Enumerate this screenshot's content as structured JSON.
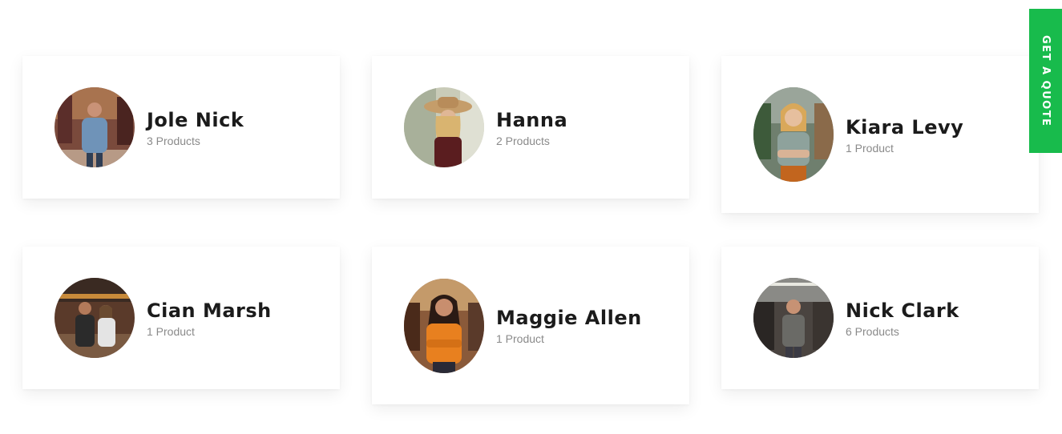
{
  "sellers": [
    {
      "name": "Jole Nick",
      "products": "3 Products",
      "photo": "man-denim-shirt-bike-shop"
    },
    {
      "name": "Hanna",
      "products": "2 Products",
      "photo": "woman-straw-hat-laughing"
    },
    {
      "name": "Kiara Levy",
      "products": "1 Product",
      "photo": "woman-arms-crossed-shop"
    },
    {
      "name": "Cian Marsh",
      "products": "1 Product",
      "photo": "couple-in-bike-shop"
    },
    {
      "name": "Maggie Allen",
      "products": "1 Product",
      "photo": "woman-orange-shirt-shop"
    },
    {
      "name": "Nick Clark",
      "products": "6 Products",
      "photo": "man-grey-shirt-warehouse"
    }
  ],
  "quote_tab": {
    "label": "GET A QUOTE"
  },
  "colors": {
    "accent": "#18bb4c",
    "name_text": "#1b1b1b",
    "meta_text": "#8a8a8a"
  }
}
